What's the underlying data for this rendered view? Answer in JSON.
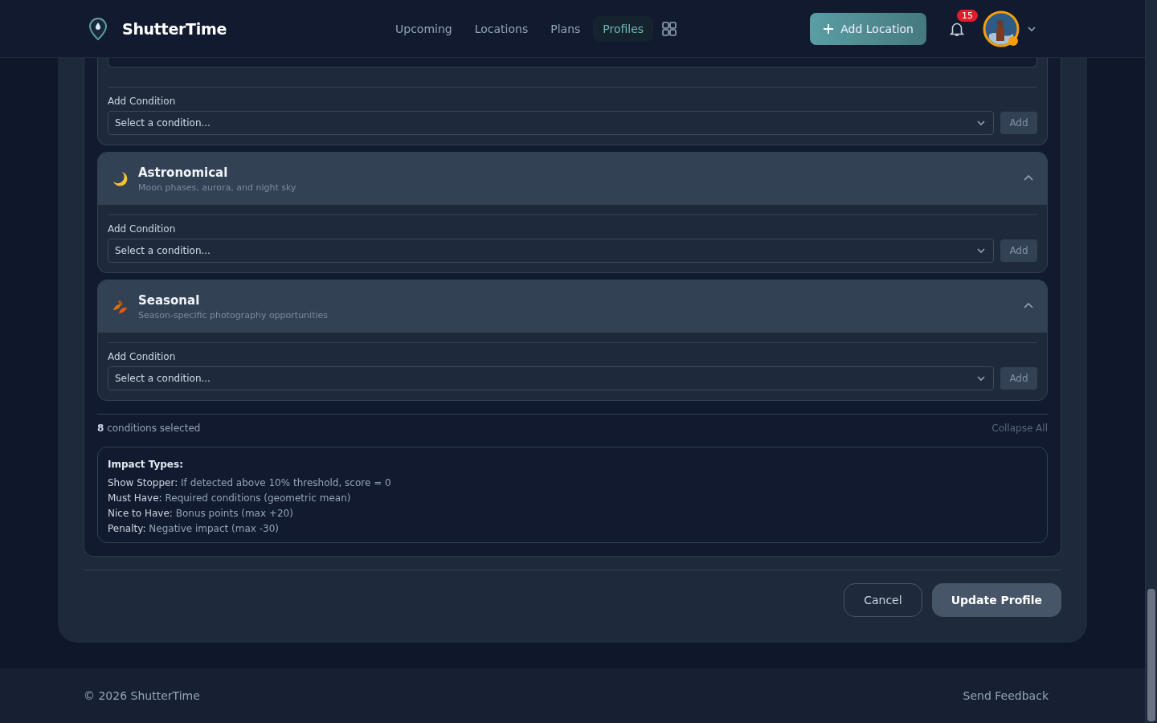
{
  "header": {
    "brand": "ShutterTime",
    "nav": [
      {
        "label": "Upcoming",
        "selected": false
      },
      {
        "label": "Locations",
        "selected": false
      },
      {
        "label": "Plans",
        "selected": false
      },
      {
        "label": "Profiles",
        "selected": true
      }
    ],
    "add_button": "Add Location",
    "notifications": "15"
  },
  "categories": [
    {
      "kind": "partial",
      "add_label": "Add Condition",
      "placeholder": "Select a condition...",
      "add_button": "Add"
    },
    {
      "kind": "moon",
      "title": "Astronomical",
      "subtitle": "Moon phases, aurora, and night sky",
      "expanded": true,
      "add_label": "Add Condition",
      "placeholder": "Select a condition...",
      "add_button": "Add"
    },
    {
      "kind": "leaf",
      "title": "Seasonal",
      "subtitle": "Season-specific photography opportunities",
      "expanded": true,
      "add_label": "Add Condition",
      "placeholder": "Select a condition...",
      "add_button": "Add"
    }
  ],
  "summary": {
    "count_text": "**8** conditions selected",
    "collapse": "Collapse All"
  },
  "legend": {
    "title": "Impact Types:",
    "items": [
      {
        "term": "Show Stopper:",
        "text": "If detected above 10% threshold, score = 0"
      },
      {
        "term": "Must Have:",
        "text": "Required conditions (geometric mean)"
      },
      {
        "term": "Nice to Have:",
        "text": "Bonus points (max +20)"
      },
      {
        "term": "Penalty:",
        "text": "Negative impact (max -30)"
      }
    ]
  },
  "actions": {
    "cancel": "Cancel",
    "submit": "Update Profile"
  },
  "footer": {
    "copyright": "© 2026 ShutterTime",
    "feedback": "Send Feedback"
  }
}
